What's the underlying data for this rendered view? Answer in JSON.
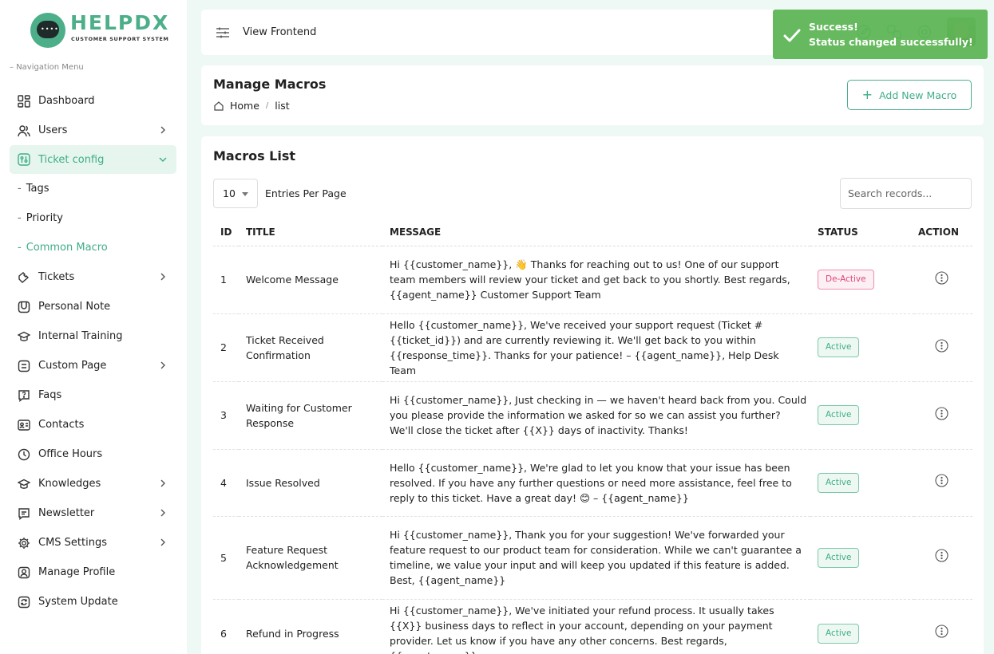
{
  "brand": {
    "name": "HELPDX",
    "tagline": "CUSTOMER SUPPORT SYSTEM",
    "accent": "#4caf8a"
  },
  "sidebar": {
    "heading": "Navigation Menu",
    "items": [
      {
        "label": "Dashboard",
        "icon": "dashboard-icon"
      },
      {
        "label": "Users",
        "icon": "users-icon",
        "has_children": true
      },
      {
        "label": "Ticket config",
        "icon": "ticket-config-icon",
        "has_children": true,
        "expanded": true
      },
      {
        "label": "Tags",
        "sub": true
      },
      {
        "label": "Priority",
        "sub": true
      },
      {
        "label": "Common Macro",
        "sub": true,
        "active": true
      },
      {
        "label": "Tickets",
        "icon": "tickets-icon",
        "has_children": true
      },
      {
        "label": "Personal Note",
        "icon": "note-icon"
      },
      {
        "label": "Internal Training",
        "icon": "graduation-cap-icon"
      },
      {
        "label": "Custom Page",
        "icon": "page-icon",
        "has_children": true
      },
      {
        "label": "Faqs",
        "icon": "faq-icon"
      },
      {
        "label": "Contacts",
        "icon": "contacts-icon"
      },
      {
        "label": "Office Hours",
        "icon": "clock-icon"
      },
      {
        "label": "Knowledges",
        "icon": "knowledge-icon",
        "has_children": true
      },
      {
        "label": "Newsletter",
        "icon": "newsletter-icon",
        "has_children": true
      },
      {
        "label": "CMS Settings",
        "icon": "gear-icon",
        "has_children": true
      },
      {
        "label": "Manage Profile",
        "icon": "profile-icon"
      },
      {
        "label": "System Update",
        "icon": "refresh-icon"
      }
    ]
  },
  "topbar": {
    "view_frontend": "View Frontend"
  },
  "page": {
    "title": "Manage Macros",
    "breadcrumb": {
      "home": "Home",
      "current": "list"
    },
    "add_button": "Add New Macro"
  },
  "list": {
    "title": "Macros List",
    "entries_value": "10",
    "entries_label": "Entries Per Page",
    "search_placeholder": "Search records...",
    "columns": {
      "id": "ID",
      "title": "TITLE",
      "message": "MESSAGE",
      "status": "STATUS",
      "action": "ACTION"
    },
    "rows": [
      {
        "id": "1",
        "title": "Welcome Message",
        "message": "Hi {{customer_name}}, 👋 Thanks for reaching out to us! One of our support team members will review your ticket and get back to you shortly. Best regards, {{agent_name}} Customer Support Team",
        "status": "De-Active",
        "status_type": "inactive"
      },
      {
        "id": "2",
        "title": "Ticket Received Confirmation",
        "message": "Hello {{customer_name}}, We've received your support request (Ticket #{{ticket_id}}) and are currently reviewing it. We'll get back to you within {{response_time}}. Thanks for your patience! – {{agent_name}}, Help Desk Team",
        "status": "Active",
        "status_type": "active"
      },
      {
        "id": "3",
        "title": "Waiting for Customer Response",
        "message": "Hi {{customer_name}}, Just checking in — we haven't heard back from you. Could you please provide the information we asked for so we can assist you further? We'll close the ticket after {{X}} days of inactivity. Thanks!",
        "status": "Active",
        "status_type": "active"
      },
      {
        "id": "4",
        "title": "Issue Resolved",
        "message": "Hello {{customer_name}}, We're glad to let you know that your issue has been resolved. If you have any further questions or need more assistance, feel free to reply to this ticket. Have a great day! 😊 – {{agent_name}}",
        "status": "Active",
        "status_type": "active"
      },
      {
        "id": "5",
        "title": "Feature Request Acknowledgement",
        "message": "Hi {{customer_name}}, Thank you for your suggestion! We've forwarded your feature request to our product team for consideration. While we can't guarantee a timeline, we value your input and will keep you updated if this feature is added. Best, {{agent_name}}",
        "status": "Active",
        "status_type": "active"
      },
      {
        "id": "6",
        "title": "Refund in Progress",
        "message": "Hi {{customer_name}}, We've initiated your refund process. It usually takes {{X}} business days to reflect in your account, depending on your payment provider. Let us know if you have any other concerns. Best regards, {{agent_name}}",
        "status": "Active",
        "status_type": "active"
      }
    ]
  },
  "toast": {
    "title": "Success!",
    "message": "Status changed successfully!",
    "color": "#5cb554"
  }
}
